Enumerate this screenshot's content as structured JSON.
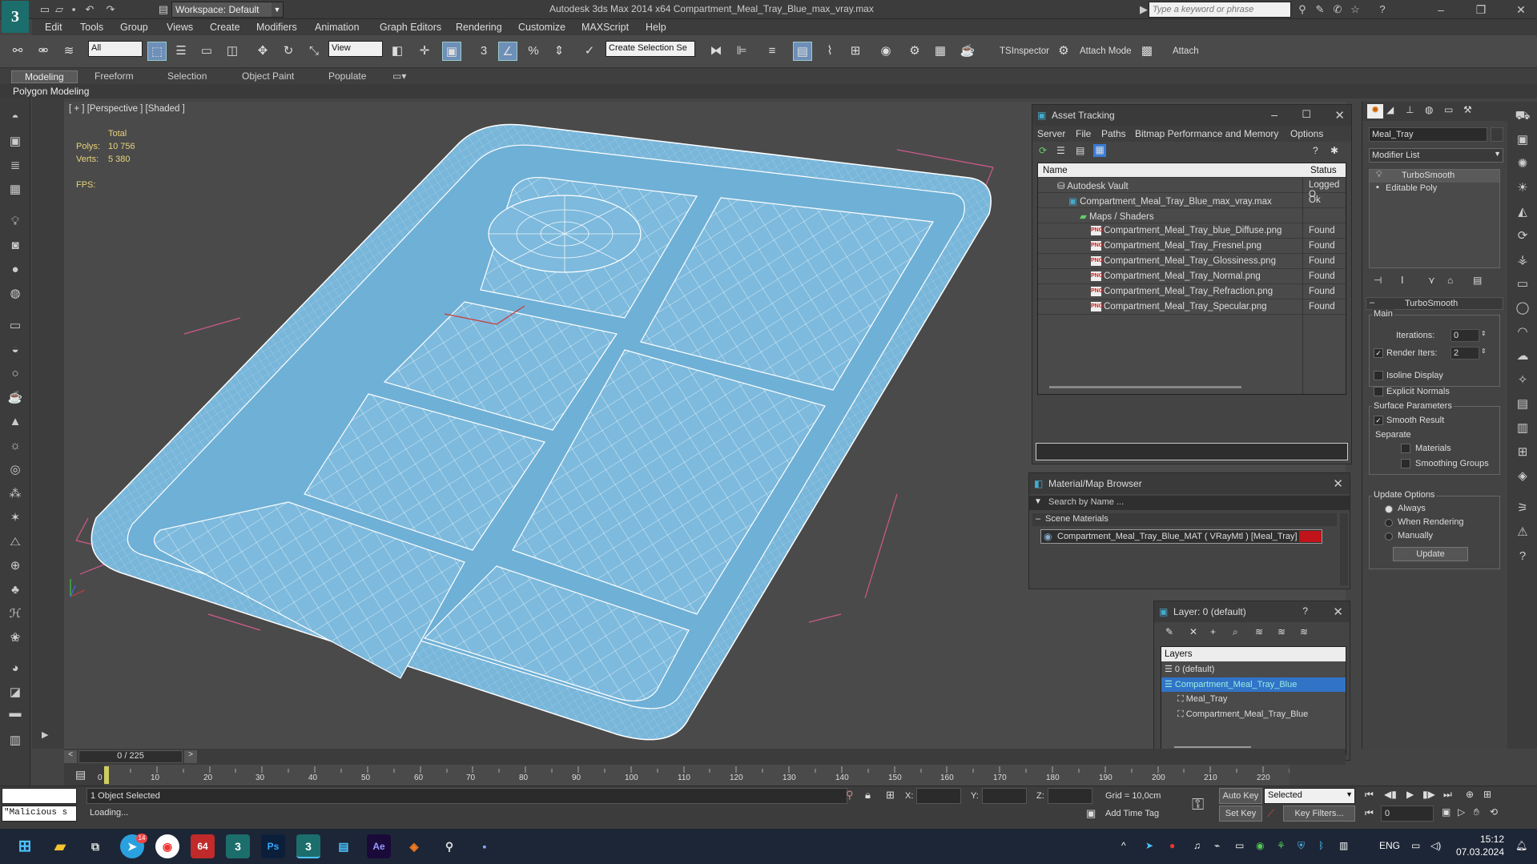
{
  "window": {
    "title": "Autodesk 3ds Max  2014 x64     Compartment_Meal_Tray_Blue_max_vray.max",
    "workspace_label": "Workspace: Default",
    "search_placeholder": "Type a keyword or phrase",
    "min": "–",
    "max": "❐",
    "close": "✕"
  },
  "menu": [
    "Edit",
    "Tools",
    "Group",
    "Views",
    "Create",
    "Modifiers",
    "Animation",
    "Graph Editors",
    "Rendering",
    "Customize",
    "MAXScript",
    "Help"
  ],
  "toolbar": {
    "filter_select": "All",
    "ref_coord": "View",
    "selection_set": "Create Selection Se",
    "ts_inspector": "TSInspector",
    "attach_mode": "Attach Mode",
    "attach": "Attach"
  },
  "ribbon": {
    "tabs": [
      "Modeling",
      "Freeform",
      "Selection",
      "Object Paint",
      "Populate"
    ],
    "active_tab": "Modeling",
    "panel": "Polygon Modeling"
  },
  "viewport": {
    "label": "[ + ] [Perspective ] [Shaded ]",
    "stats_total": "Total",
    "polys_label": "Polys:",
    "polys_value": "10 756",
    "verts_label": "Verts:",
    "verts_value": "5 380",
    "fps_label": "FPS:"
  },
  "asset_tracking": {
    "title": "Asset Tracking",
    "menu": [
      "Server",
      "File",
      "Paths",
      "Bitmap Performance and Memory",
      "Options"
    ],
    "col_name": "Name",
    "col_status": "Status",
    "rows": [
      {
        "name": "Autodesk Vault",
        "status": "Logged O"
      },
      {
        "name": "Compartment_Meal_Tray_Blue_max_vray.max",
        "status": "Ok"
      },
      {
        "name": "Maps / Shaders",
        "status": ""
      },
      {
        "name": "Compartment_Meal_Tray_blue_Diffuse.png",
        "status": "Found"
      },
      {
        "name": "Compartment_Meal_Tray_Fresnel.png",
        "status": "Found"
      },
      {
        "name": "Compartment_Meal_Tray_Glossiness.png",
        "status": "Found"
      },
      {
        "name": "Compartment_Meal_Tray_Normal.png",
        "status": "Found"
      },
      {
        "name": "Compartment_Meal_Tray_Refraction.png",
        "status": "Found"
      },
      {
        "name": "Compartment_Meal_Tray_Specular.png",
        "status": "Found"
      }
    ]
  },
  "material_browser": {
    "title": "Material/Map Browser",
    "search_placeholder": "Search by Name ...",
    "group": "Scene Materials",
    "material": "Compartment_Meal_Tray_Blue_MAT  ( VRayMtl )  [Meal_Tray]"
  },
  "layer_panel": {
    "title": "Layer: 0 (default)",
    "help": "?",
    "header": "Layers",
    "rows": [
      {
        "name": "0 (default)",
        "selected": false,
        "indent": 0
      },
      {
        "name": "Compartment_Meal_Tray_Blue",
        "selected": true,
        "indent": 0
      },
      {
        "name": "Meal_Tray",
        "selected": false,
        "indent": 1
      },
      {
        "name": "Compartment_Meal_Tray_Blue",
        "selected": false,
        "indent": 1
      }
    ]
  },
  "command_panel": {
    "object_name": "Meal_Tray",
    "modifier_list": "Modifier List",
    "stack": [
      "TurboSmooth",
      "Editable Poly"
    ],
    "rollout_title": "TurboSmooth",
    "main_label": "Main",
    "iterations_label": "Iterations:",
    "iterations_value": "0",
    "render_iters_label": "Render Iters:",
    "render_iters_value": "2",
    "isoline": "Isoline Display",
    "explicit_normals": "Explicit Normals",
    "surface_params": "Surface Parameters",
    "smooth_result": "Smooth Result",
    "separate": "Separate",
    "materials": "Materials",
    "smoothing_groups": "Smoothing Groups",
    "update_options": "Update Options",
    "always": "Always",
    "when_rendering": "When Rendering",
    "manually": "Manually",
    "update_button": "Update"
  },
  "timeline": {
    "frame_counter": "0 / 225",
    "ticks": [
      "0",
      "10",
      "20",
      "30",
      "40",
      "50",
      "60",
      "70",
      "80",
      "90",
      "100",
      "110",
      "120",
      "130",
      "140",
      "150",
      "160",
      "170",
      "180",
      "190",
      "200",
      "210",
      "220"
    ]
  },
  "status": {
    "script_listener": "\"Malicious s",
    "selection": "1 Object Selected",
    "loading": "Loading...",
    "x_label": "X:",
    "y_label": "Y:",
    "z_label": "Z:",
    "grid": "Grid = 10,0cm",
    "auto_key": "Auto Key",
    "selected_dropdown": "Selected",
    "set_key": "Set Key",
    "key_filters": "Key Filters...",
    "add_time_tag": "Add Time Tag",
    "frame_value": "0"
  },
  "taskbar": {
    "badge_telegram": "14",
    "app_64": "64",
    "app_ps": "Ps",
    "app_ae": "Ae",
    "lang": "ENG",
    "time": "15:12",
    "date": "07.03.2024"
  },
  "colors": {
    "tray": "#78b6da",
    "wire": "#ffffff",
    "selection": "#3173c7",
    "material_swatch": "#c0141a"
  }
}
